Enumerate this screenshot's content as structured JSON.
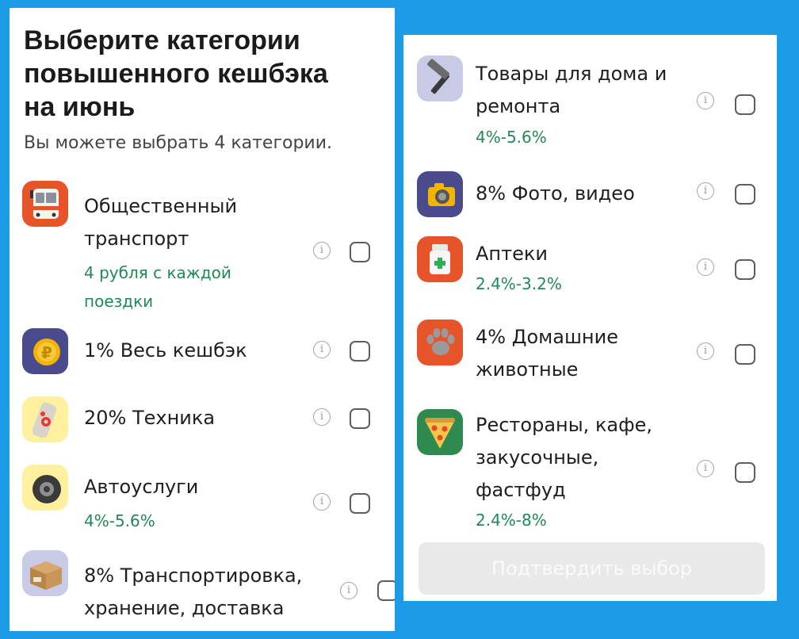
{
  "left_panel": {
    "title_lines": [
      "Выберите категории",
      "повышенного кешбэка",
      "на июнь"
    ],
    "subtitle": "Вы можете выбрать 4 категории.",
    "items": [
      {
        "label_lines": [
          "Общественный",
          "транспорт"
        ],
        "cashback_lines": [
          "4 рубля с каждой",
          "поездки"
        ],
        "icon": "bus-icon",
        "icon_bg": "#e8542a"
      },
      {
        "label_lines": [
          "1% Весь кешбэк"
        ],
        "cashback_lines": [],
        "icon": "ruble-coin-icon",
        "icon_bg": "#4a4b8c"
      },
      {
        "label_lines": [
          "20% Техника"
        ],
        "cashback_lines": [],
        "icon": "remote-control-icon",
        "icon_bg": "#fff0a0"
      },
      {
        "label_lines": [
          "Автоуслуги"
        ],
        "cashback_lines": [
          "4%-5.6%"
        ],
        "icon": "tire-icon",
        "icon_bg": "#fff0a0"
      },
      {
        "label_lines": [
          "8% Транспортировка,",
          "хранение, доставка"
        ],
        "cashback_lines": [],
        "icon": "parcel-box-icon",
        "icon_bg": "#c9cbe6"
      }
    ]
  },
  "right_panel": {
    "items": [
      {
        "label_lines": [
          "Товары для дома и",
          "ремонта"
        ],
        "cashback_lines": [
          "4%-5.6%"
        ],
        "icon": "hammer-icon",
        "icon_bg": "#c9cbe6"
      },
      {
        "label_lines": [
          "8% Фото, видео"
        ],
        "cashback_lines": [],
        "icon": "camera-icon",
        "icon_bg": "#4a4b8c"
      },
      {
        "label_lines": [
          "Аптеки"
        ],
        "cashback_lines": [
          "2.4%-3.2%"
        ],
        "icon": "medicine-bottle-icon",
        "icon_bg": "#e8542a"
      },
      {
        "label_lines": [
          "4% Домашние",
          "животные"
        ],
        "cashback_lines": [],
        "icon": "paw-icon",
        "icon_bg": "#e8542a"
      },
      {
        "label_lines": [
          "Рестораны, кафе,",
          "закусочные,",
          "фастфуд"
        ],
        "cashback_lines": [
          "2.4%-8%"
        ],
        "icon": "pizza-icon",
        "icon_bg": "#2f8a4f"
      }
    ],
    "confirm_button": "Подтвердить выбор"
  },
  "info_glyph": "i",
  "colors": {
    "background": "#1e9be6",
    "cashback_text": "#1f8a55",
    "button_disabled": "#e9e9e9"
  }
}
